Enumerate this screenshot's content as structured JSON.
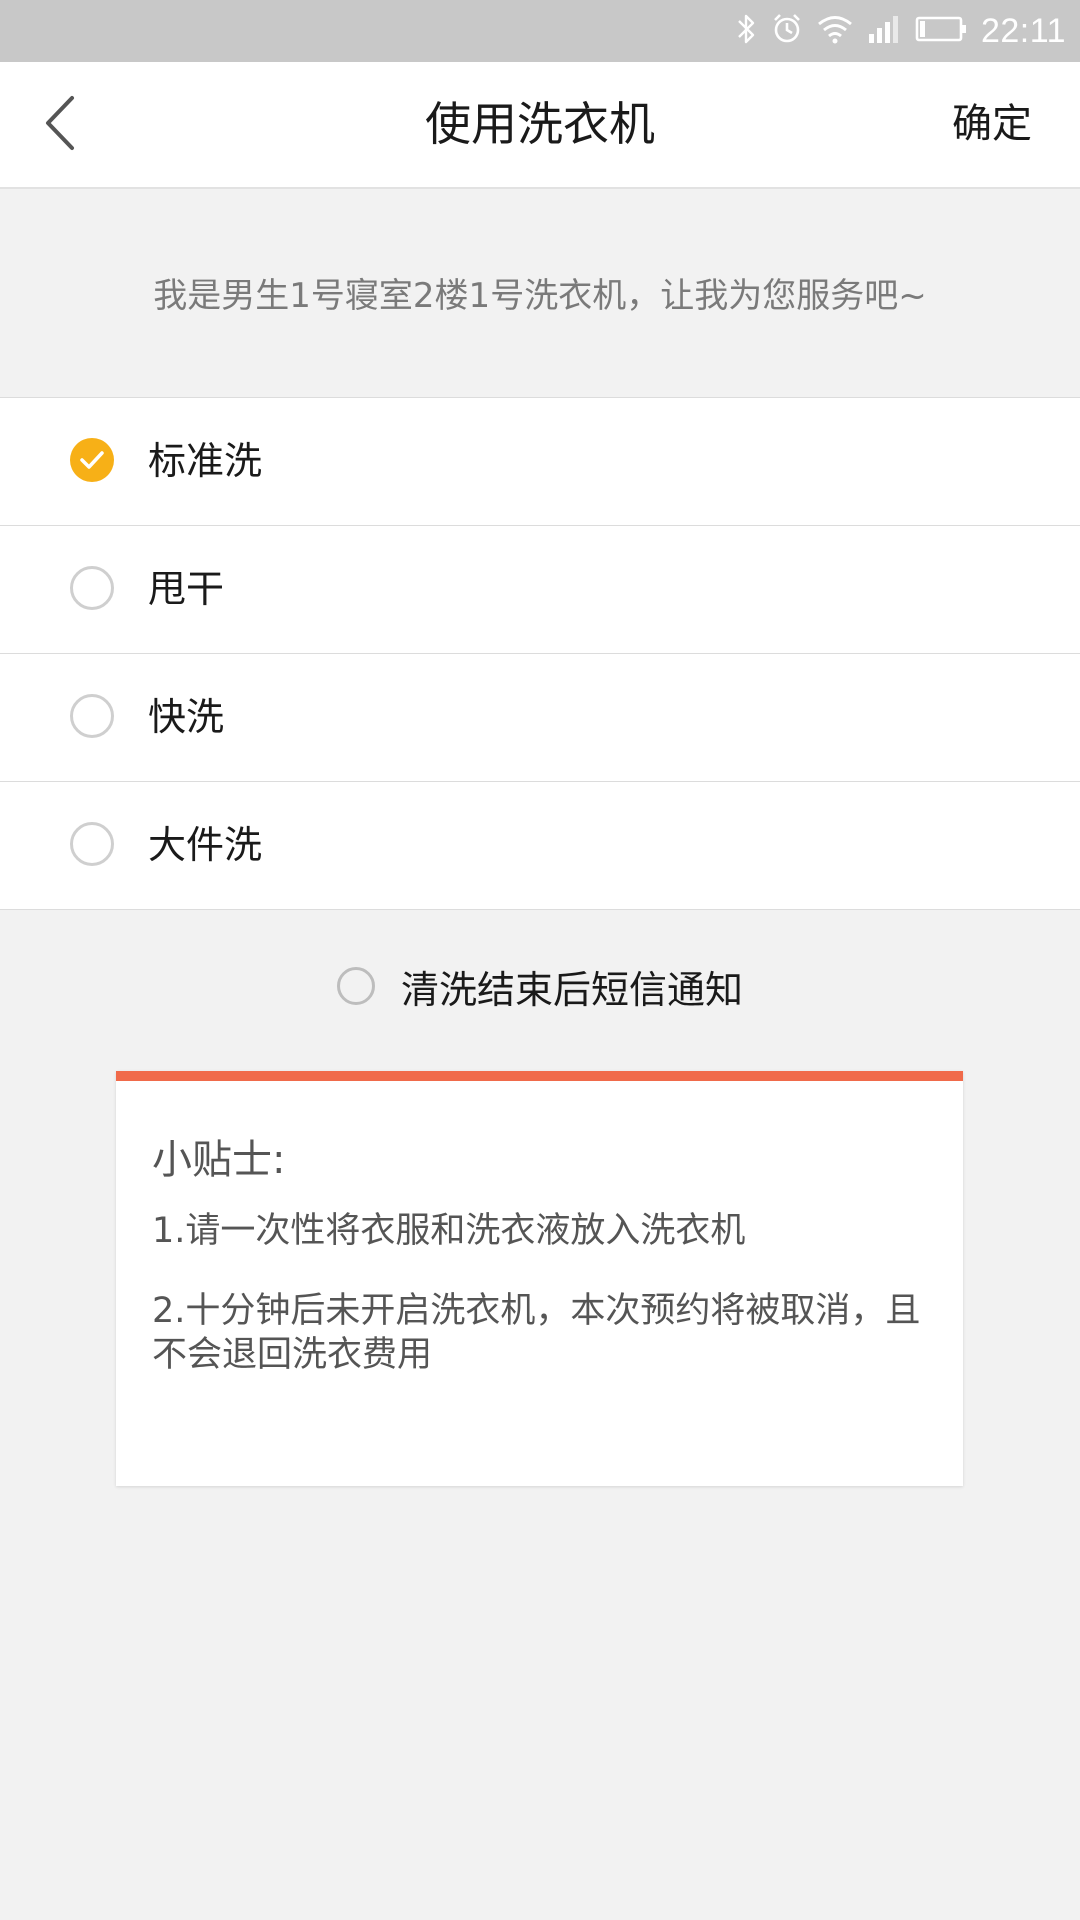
{
  "status_bar": {
    "time": "22:11",
    "icons": [
      "bluetooth-icon",
      "alarm-icon",
      "wifi-icon",
      "signal-icon",
      "battery-icon"
    ]
  },
  "header": {
    "title": "使用洗衣机",
    "confirm_label": "确定",
    "back_icon": "chevron-left-icon"
  },
  "intro": "我是男生1号寝室2楼1号洗衣机，让我为您服务吧~",
  "modes": [
    {
      "label": "标准洗",
      "selected": true
    },
    {
      "label": "甩干",
      "selected": false
    },
    {
      "label": "快洗",
      "selected": false
    },
    {
      "label": "大件洗",
      "selected": false
    }
  ],
  "sms_option": {
    "label": "清洗结束后短信通知",
    "checked": false
  },
  "tips": {
    "title": "小贴士:",
    "items": [
      "1.请一次性将衣服和洗衣液放入洗衣机",
      "2.十分钟后未开启洗衣机，本次预约将被取消，且不会退回洗衣费用"
    ]
  },
  "colors": {
    "accent_check": "#f7b017",
    "tips_border": "#f06a4a",
    "status_bar": "#c8c8c8",
    "background": "#f2f2f2"
  }
}
